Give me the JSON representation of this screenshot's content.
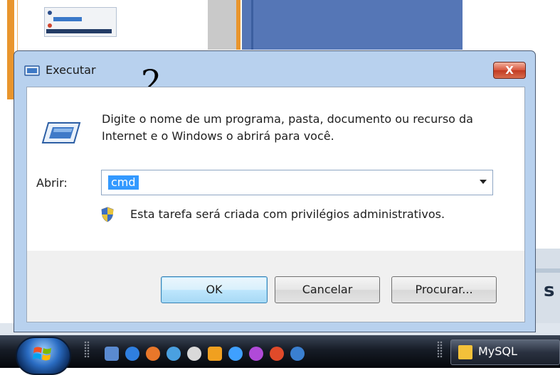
{
  "dialog": {
    "title": "Executar",
    "close_label": "X",
    "annotation": "2",
    "description": "Digite o nome de um programa, pasta, documento ou recurso da Internet e o Windows o abrirá para você.",
    "open_label": "Abrir:",
    "open_value": "cmd",
    "admin_note": "Esta tarefa será criada com privilégios administrativos.",
    "buttons": {
      "ok": "OK",
      "cancel": "Cancelar",
      "browse": "Procurar..."
    }
  },
  "taskbar": {
    "active_window": "MySQL",
    "quick_launch_icons": [
      "show-desktop-icon",
      "ie-icon",
      "firefox-icon",
      "app-icon",
      "app-icon",
      "media-icon",
      "search-icon",
      "app-icon",
      "chrome-icon",
      "app-icon"
    ]
  },
  "colors": {
    "dialog_frame": "#b8d1ee",
    "selection": "#3399ff",
    "close_button": "#d7553c"
  }
}
